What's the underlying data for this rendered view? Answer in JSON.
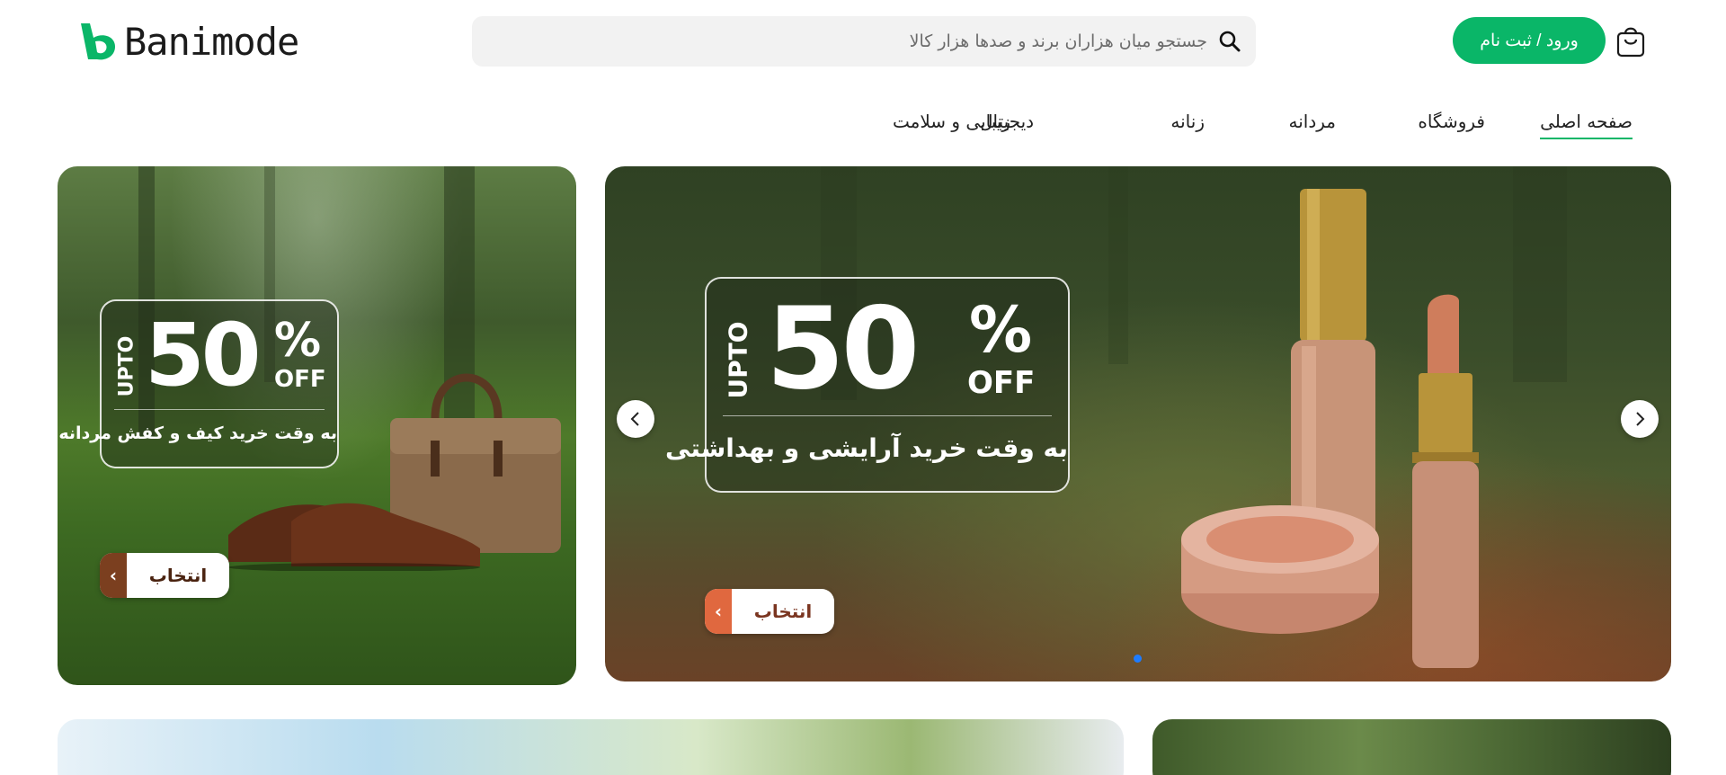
{
  "header": {
    "brand": "Banimode",
    "search_placeholder": "جستجو میان هزاران برند و صدها هزار کالا",
    "login_label": "ورود / ثبت نام",
    "colors": {
      "accent": "#0ab668",
      "search_bg": "#f2f2f2"
    }
  },
  "nav": {
    "items": [
      {
        "label": "صفحه اصلی",
        "active": true
      },
      {
        "label": "فروشگاه",
        "active": false
      },
      {
        "label": "مردانه",
        "active": false
      },
      {
        "label": "زنانه",
        "active": false
      },
      {
        "label": "زیبایی و سلامت",
        "active": false
      },
      {
        "label": "دیجیتال",
        "active": false
      }
    ]
  },
  "banners": {
    "main": {
      "upto": "UPTO",
      "number": "50",
      "percent": "%",
      "off": "OFF",
      "caption": "به وقت خرید آرایشی و بهداشتی",
      "button_label": "انتخاب",
      "accent": "#e0683f"
    },
    "side": {
      "upto": "UPTO",
      "number": "50",
      "percent": "%",
      "off": "OFF",
      "caption": "به وقت خرید کیف و کفش مردانه",
      "button_label": "انتخاب",
      "accent": "#7b3f1f"
    }
  },
  "slider": {
    "dot_color": "#1e7cff"
  }
}
